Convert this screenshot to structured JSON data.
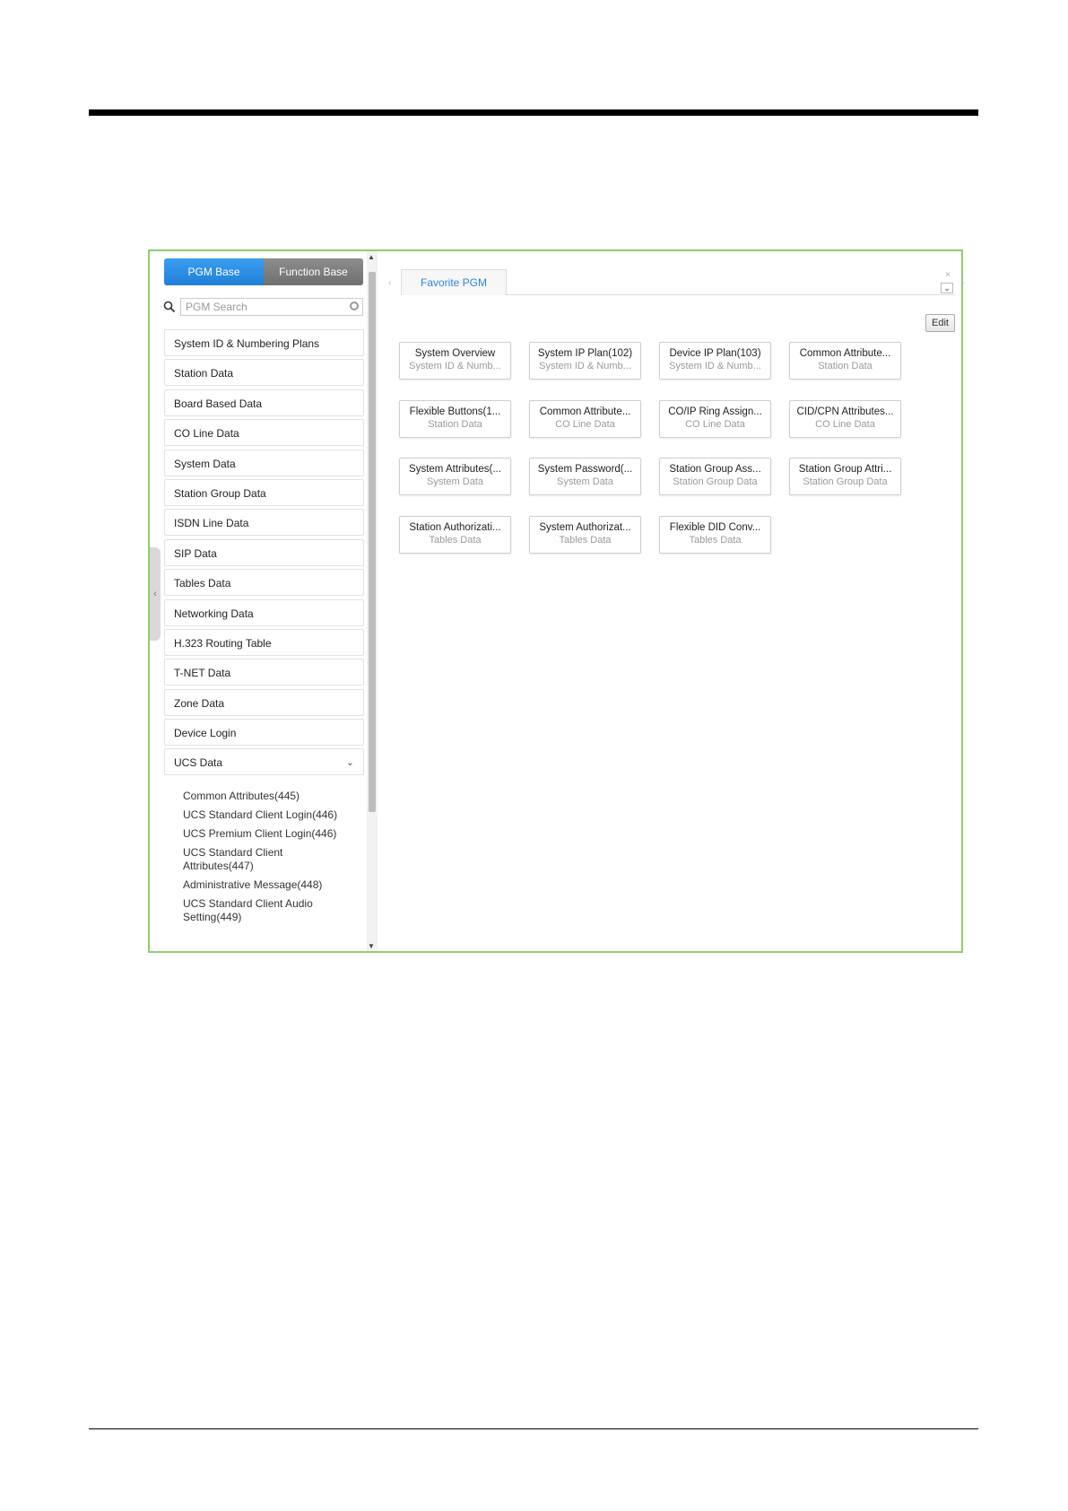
{
  "left_panel": {
    "mode_tabs": [
      "PGM Base",
      "Function Base"
    ],
    "search_placeholder": "PGM Search",
    "menu_items": [
      "System ID & Numbering Plans",
      "Station Data",
      "Board Based Data",
      "CO Line Data",
      "System Data",
      "Station Group Data",
      "ISDN Line Data",
      "SIP Data",
      "Tables Data",
      "Networking Data",
      "H.323 Routing Table",
      "T-NET Data",
      "Zone Data",
      "Device Login"
    ],
    "expanded_item": "UCS Data",
    "sub_items": [
      "Common Attributes(445)",
      "UCS Standard Client Login(446)",
      "UCS Premium Client Login(446)",
      "UCS Standard Client Attributes(447)",
      "Administrative Message(448)",
      "UCS Standard Client Audio Setting(449)"
    ]
  },
  "right_panel": {
    "tab_label": "Favorite PGM",
    "edit_label": "Edit",
    "cards": [
      {
        "title": "System Overview",
        "sub": "System ID & Numb..."
      },
      {
        "title": "System IP Plan(102)",
        "sub": "System ID & Numb..."
      },
      {
        "title": "Device IP Plan(103)",
        "sub": "System ID & Numb..."
      },
      {
        "title": "Common Attribute...",
        "sub": "Station Data"
      },
      {
        "title": "Flexible Buttons(1...",
        "sub": "Station Data"
      },
      {
        "title": "Common Attribute...",
        "sub": "CO Line Data"
      },
      {
        "title": "CO/IP Ring Assign...",
        "sub": "CO Line Data"
      },
      {
        "title": "CID/CPN Attributes...",
        "sub": "CO Line Data"
      },
      {
        "title": "System Attributes(...",
        "sub": "System Data"
      },
      {
        "title": "System Password(...",
        "sub": "System Data"
      },
      {
        "title": "Station Group Ass...",
        "sub": "Station Group Data"
      },
      {
        "title": "Station Group Attri...",
        "sub": "Station Group Data"
      },
      {
        "title": "Station Authorizati...",
        "sub": "Tables Data"
      },
      {
        "title": "System Authorizat...",
        "sub": "Tables Data"
      },
      {
        "title": "Flexible DID Conv...",
        "sub": "Tables Data"
      }
    ]
  },
  "colors": {
    "frame_border": "#8cd06a",
    "active_tab": "#1f7fd8",
    "inactive_tab": "#6f6f6f",
    "link_blue": "#2e86d9"
  },
  "icons": [
    "search-icon",
    "clear-icon",
    "chevron-down-icon",
    "chevron-left-icon",
    "chevron-right-icon",
    "close-icon",
    "scroll-up-icon",
    "scroll-down-icon"
  ]
}
